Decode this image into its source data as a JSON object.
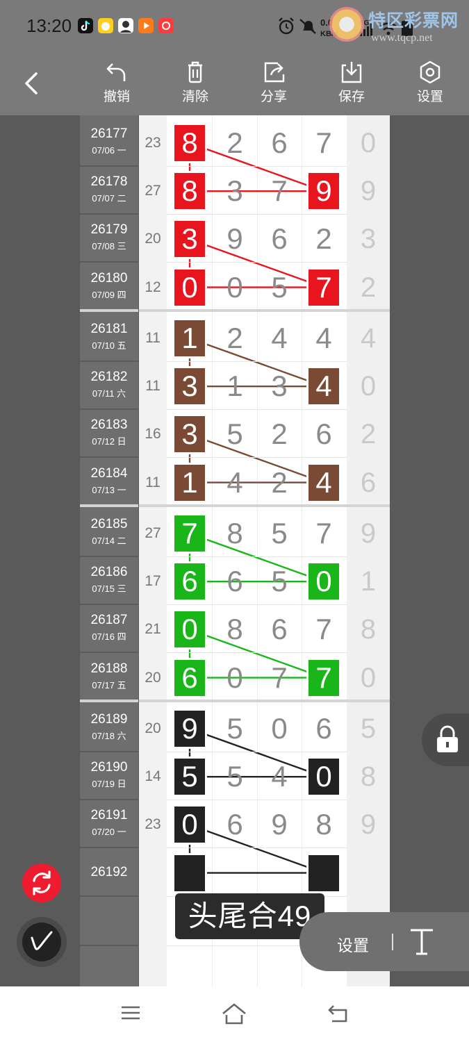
{
  "status_bar": {
    "time": "13:20",
    "net_speed": "0.0",
    "net_unit": "KB/s",
    "net_type": "5G"
  },
  "watermark": {
    "title": "特区彩票网",
    "url": "www.tqcp.net"
  },
  "toolbar": {
    "undo": "撤销",
    "clear": "清除",
    "share": "分享",
    "save": "保存",
    "settings": "设置"
  },
  "groups": [
    {
      "color": "#e8141e",
      "rows": [
        {
          "issue": "26177",
          "date": "07/06 一",
          "sum": "23",
          "digits": [
            "8",
            "2",
            "6",
            "7"
          ],
          "extra": "0",
          "hl": [
            0
          ]
        },
        {
          "issue": "26178",
          "date": "07/07 二",
          "sum": "27",
          "digits": [
            "8",
            "3",
            "7",
            "9"
          ],
          "extra": "9",
          "hl": [
            0,
            3
          ]
        },
        {
          "issue": "26179",
          "date": "07/08 三",
          "sum": "20",
          "digits": [
            "3",
            "9",
            "6",
            "2"
          ],
          "extra": "3",
          "hl": [
            0
          ]
        },
        {
          "issue": "26180",
          "date": "07/09 四",
          "sum": "12",
          "digits": [
            "0",
            "0",
            "5",
            "7"
          ],
          "extra": "2",
          "hl": [
            0,
            3
          ]
        }
      ]
    },
    {
      "color": "#7a4a35",
      "rows": [
        {
          "issue": "26181",
          "date": "07/10 五",
          "sum": "11",
          "digits": [
            "1",
            "2",
            "4",
            "4"
          ],
          "extra": "4",
          "hl": [
            0
          ]
        },
        {
          "issue": "26182",
          "date": "07/11 六",
          "sum": "11",
          "digits": [
            "3",
            "1",
            "3",
            "4"
          ],
          "extra": "0",
          "hl": [
            0,
            3
          ]
        },
        {
          "issue": "26183",
          "date": "07/12 日",
          "sum": "16",
          "digits": [
            "3",
            "5",
            "2",
            "6"
          ],
          "extra": "2",
          "hl": [
            0
          ]
        },
        {
          "issue": "26184",
          "date": "07/13 一",
          "sum": "11",
          "digits": [
            "1",
            "4",
            "2",
            "4"
          ],
          "extra": "6",
          "hl": [
            0,
            3
          ]
        }
      ]
    },
    {
      "color": "#19b519",
      "rows": [
        {
          "issue": "26185",
          "date": "07/14 二",
          "sum": "27",
          "digits": [
            "7",
            "8",
            "5",
            "7"
          ],
          "extra": "9",
          "hl": [
            0
          ]
        },
        {
          "issue": "26186",
          "date": "07/15 三",
          "sum": "17",
          "digits": [
            "6",
            "6",
            "5",
            "0"
          ],
          "extra": "1",
          "hl": [
            0,
            3
          ]
        },
        {
          "issue": "26187",
          "date": "07/16 四",
          "sum": "21",
          "digits": [
            "0",
            "8",
            "6",
            "7"
          ],
          "extra": "8",
          "hl": [
            0
          ]
        },
        {
          "issue": "26188",
          "date": "07/17 五",
          "sum": "20",
          "digits": [
            "6",
            "0",
            "7",
            "7"
          ],
          "extra": "0",
          "hl": [
            0,
            3
          ]
        }
      ]
    },
    {
      "color": "#222222",
      "rows": [
        {
          "issue": "26189",
          "date": "07/18 六",
          "sum": "20",
          "digits": [
            "9",
            "5",
            "0",
            "6"
          ],
          "extra": "5",
          "hl": [
            0
          ]
        },
        {
          "issue": "26190",
          "date": "07/19 日",
          "sum": "14",
          "digits": [
            "5",
            "5",
            "4",
            "0"
          ],
          "extra": "8",
          "hl": [
            0,
            3
          ]
        },
        {
          "issue": "26191",
          "date": "07/20 一",
          "sum": "23",
          "digits": [
            "0",
            "6",
            "9",
            "8"
          ],
          "extra": "9",
          "hl": [
            0
          ]
        },
        {
          "issue": "26192",
          "date": "",
          "sum": "",
          "digits": [
            "",
            "",
            "",
            ""
          ],
          "extra": "",
          "hl": [
            0,
            3
          ],
          "pending": true
        }
      ]
    }
  ],
  "caption": "头尾合49",
  "text_panel": {
    "label": "设置",
    "glyph": "T"
  }
}
